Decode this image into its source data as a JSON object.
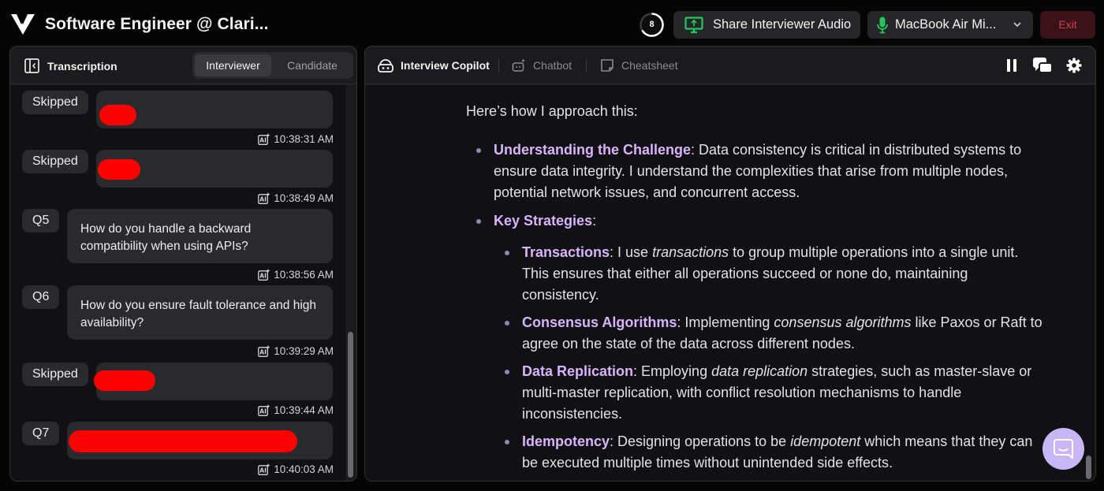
{
  "header": {
    "title": "Software Engineer @ Clari...",
    "timer_count": "8",
    "share_audio_label": "Share Interviewer Audio",
    "mic_label": "MacBook Air Mi...",
    "exit_label": "Exit"
  },
  "transcription": {
    "title": "Transcription",
    "tabs": [
      "Interviewer",
      "Candidate"
    ],
    "active_tab": "Interviewer",
    "items": [
      {
        "tag": "Skipped",
        "text": "",
        "redacted": true,
        "time": "10:38:31 AM"
      },
      {
        "tag": "Skipped",
        "text": "",
        "redacted": true,
        "time": "10:38:49 AM"
      },
      {
        "tag": "Q5",
        "text": "How do you handle a backward compatibility when using APIs?",
        "redacted": false,
        "time": "10:38:56 AM"
      },
      {
        "tag": "Q6",
        "text": "How do you ensure fault tolerance and high availability?",
        "redacted": false,
        "time": "10:39:29 AM"
      },
      {
        "tag": "Skipped",
        "text": "",
        "redacted": true,
        "time": "10:39:44 AM"
      },
      {
        "tag": "Q7",
        "text": "",
        "redacted": true,
        "time": "10:40:03 AM"
      }
    ]
  },
  "copilot": {
    "tabs": [
      "Interview Copilot",
      "Chatbot",
      "Cheatsheet"
    ],
    "intro": "Here’s how I approach this:",
    "points": [
      {
        "title": "Understanding the Challenge",
        "text": ": Data consistency is critical in distributed systems to ensure data integrity. I understand the complexities that arise from multiple nodes, potential network issues, and concurrent access."
      },
      {
        "title": "Key Strategies",
        "text": ":"
      }
    ],
    "strategies": [
      {
        "title": "Transactions",
        "pre": ": I use ",
        "em": "transactions",
        "post": " to group multiple operations into a single unit. This ensures that either all operations succeed or none do, maintaining consistency."
      },
      {
        "title": "Consensus Algorithms",
        "pre": ": Implementing ",
        "em": "consensus algorithms",
        "post": " like Paxos or Raft to agree on the state of the data across different nodes."
      },
      {
        "title": "Data Replication",
        "pre": ": Employing ",
        "em": "data replication",
        "post": " strategies, such as master-slave or multi-master replication, with conflict resolution mechanisms to handle inconsistencies."
      },
      {
        "title": "Idempotency",
        "pre": ": Designing operations to be ",
        "em": "idempotent",
        "post": " which means that they can be executed multiple times without unintended side effects."
      }
    ]
  },
  "colors": {
    "accent_purple": "#d8b4fe",
    "share_icon_green": "#22c55e",
    "mic_icon_green": "#22c55e",
    "exit_red": "#c9434f",
    "redaction_red": "#ff0000"
  }
}
